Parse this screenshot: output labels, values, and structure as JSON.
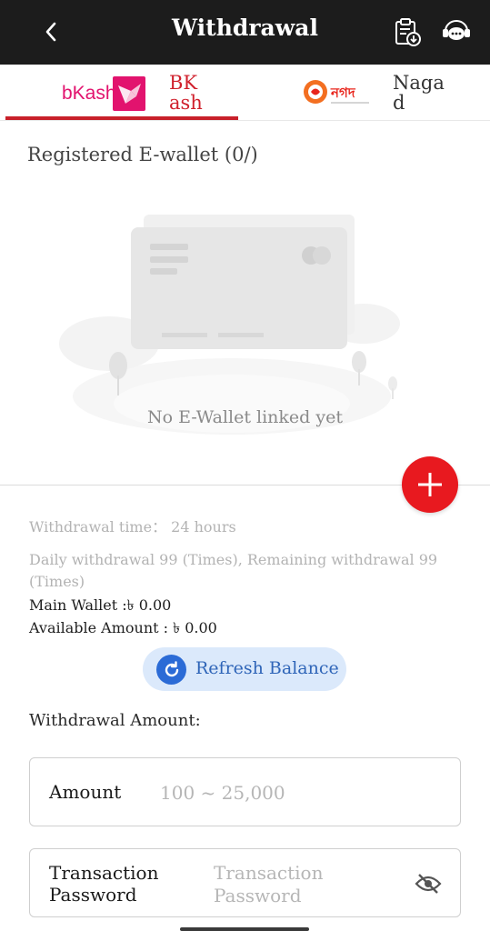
{
  "header": {
    "title": "Withdrawal",
    "back_icon": "chevron-left-icon",
    "history_icon": "clipboard-download-icon",
    "support_icon": "chat-support-icon",
    "background_color": "#1c1c1c"
  },
  "tabs": [
    {
      "logo_text": "bKash",
      "label": "BK\nash",
      "active": true,
      "accent_color": "#e2136e"
    },
    {
      "logo_text": "নগদ",
      "label": "Naga\nd",
      "active": false,
      "accent_color": "#e8251c"
    }
  ],
  "wallet": {
    "title": "Registered E-wallet (0/)",
    "empty_text": "No E-Wallet linked yet",
    "add_icon": "plus-icon",
    "add_color": "#e8191f"
  },
  "info": {
    "withdrawal_time": "Withdrawal time： 24 hours",
    "daily_withdrawal": "Daily withdrawal 99 (Times), Remaining withdrawal 99 (Times)",
    "main_wallet": "Main Wallet :৳ 0.00",
    "available_amount": "Available Amount : ৳ 0.00"
  },
  "refresh": {
    "label": "Refresh Balance",
    "icon": "refresh-icon"
  },
  "form": {
    "heading": "Withdrawal Amount:",
    "amount_label": "Amount",
    "amount_placeholder": "100 ~ 25,000",
    "password_label": "Transaction Password",
    "password_placeholder": "Transaction Password",
    "visibility_icon": "eye-off-icon"
  }
}
